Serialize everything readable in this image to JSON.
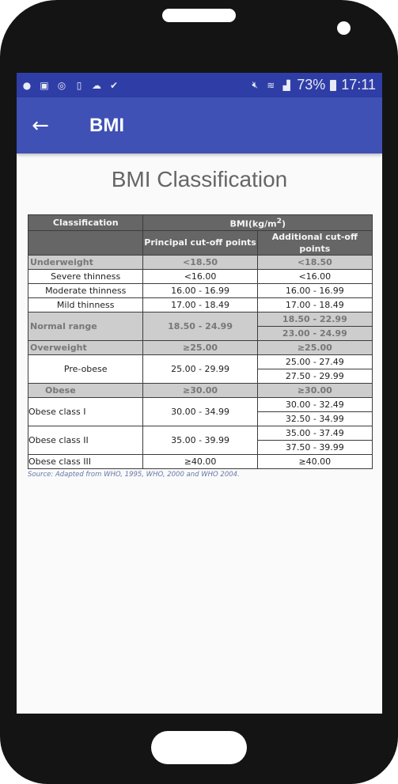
{
  "statusbar": {
    "left_icons": [
      "messenger-icon",
      "gallery-icon",
      "sync-icon",
      "file-timer-icon",
      "cloud-icon",
      "task-check-icon"
    ],
    "right_icons": [
      "mute-icon",
      "wifi-icon",
      "signal-icon"
    ],
    "battery_percent": "73%",
    "time": "17:11"
  },
  "appbar": {
    "title": "BMI",
    "back_icon": "arrow-left-icon"
  },
  "page": {
    "title": "BMI Classification"
  },
  "table": {
    "header": {
      "classification": "Classification",
      "bmi": "BMI(kg/m²)",
      "principal": "Principal cut-off points",
      "additional": "Additional cut-off points"
    },
    "rows": [
      {
        "label": "Underweight",
        "principal": "<18.50",
        "additional": [
          "<18.50"
        ],
        "type": "group"
      },
      {
        "label": "Severe thinness",
        "principal": "<16.00",
        "additional": [
          "<16.00"
        ],
        "type": "sub"
      },
      {
        "label": "Moderate thinness",
        "principal": "16.00 - 16.99",
        "additional": [
          "16.00 - 16.99"
        ],
        "type": "sub"
      },
      {
        "label": "Mild thinness",
        "principal": "17.00 - 18.49",
        "additional": [
          "17.00 - 18.49"
        ],
        "type": "sub"
      },
      {
        "label": "Normal range",
        "principal": "18.50 - 24.99",
        "additional": [
          "18.50 - 22.99",
          "23.00 - 24.99"
        ],
        "type": "group"
      },
      {
        "label": "Overweight",
        "principal": "≥25.00",
        "additional": [
          "≥25.00"
        ],
        "type": "group"
      },
      {
        "label": "Pre-obese",
        "principal": "25.00 - 29.99",
        "additional": [
          "25.00 - 27.49",
          "27.50 - 29.99"
        ],
        "type": "sub"
      },
      {
        "label": "Obese",
        "principal": "≥30.00",
        "additional": [
          "≥30.00"
        ],
        "type": "group-indent"
      },
      {
        "label": "Obese class I",
        "principal": "30.00 - 34.99",
        "additional": [
          "30.00 - 32.49",
          "32.50 - 34.99"
        ],
        "type": "sub2"
      },
      {
        "label": "Obese class II",
        "principal": "35.00 - 39.99",
        "additional": [
          "35.00 - 37.49",
          "37.50 - 39.99"
        ],
        "type": "sub2"
      },
      {
        "label": "Obese class III",
        "principal": "≥40.00",
        "additional": [
          "≥40.00"
        ],
        "type": "sub2"
      }
    ],
    "source": "Source: Adapted from WHO, 1995, WHO, 2000 and WHO 2004."
  }
}
